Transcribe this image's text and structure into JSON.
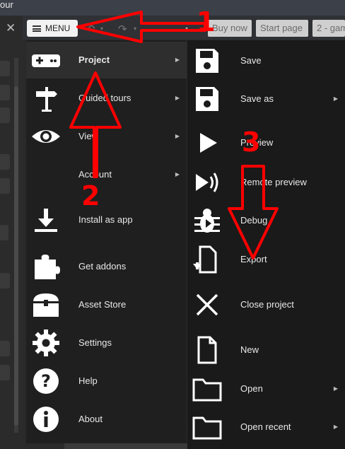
{
  "titlebar": {
    "text": "our"
  },
  "toolbar": {
    "menu_label": "MENU",
    "tabs": [
      "Buy now",
      "Start page",
      "2 - gam"
    ]
  },
  "main_menu": {
    "items": [
      {
        "label": "Project",
        "icon": "gamepad-icon",
        "has_submenu": true,
        "active": true
      },
      {
        "label": "Guided tours",
        "icon": "signpost-icon",
        "has_submenu": true
      },
      {
        "label": "View",
        "icon": "eye-icon",
        "has_submenu": true
      },
      {
        "label": "Account",
        "icon": "blank-icon",
        "has_submenu": true
      },
      {
        "label": "Install as app",
        "icon": "download-icon",
        "has_submenu": false
      },
      {
        "label": "Get addons",
        "icon": "puzzle-icon",
        "has_submenu": false
      },
      {
        "label": "Asset Store",
        "icon": "treasure-chest-icon",
        "has_submenu": false
      },
      {
        "label": "Settings",
        "icon": "gear-icon",
        "has_submenu": false
      },
      {
        "label": "Help",
        "icon": "question-icon",
        "has_submenu": false
      },
      {
        "label": "About",
        "icon": "info-icon",
        "has_submenu": false
      }
    ]
  },
  "sub_menu": {
    "items": [
      {
        "label": "Save",
        "icon": "floppy-disk-icon",
        "has_submenu": false
      },
      {
        "label": "Save as",
        "icon": "floppy-disk-icon",
        "has_submenu": true
      },
      {
        "label": "Preview",
        "icon": "play-icon",
        "has_submenu": false
      },
      {
        "label": "Remote preview",
        "icon": "remote-play-icon",
        "has_submenu": false
      },
      {
        "label": "Debug",
        "icon": "bug-icon",
        "has_submenu": false
      },
      {
        "label": "Export",
        "icon": "export-file-icon",
        "has_submenu": false
      },
      {
        "label": "Close project",
        "icon": "close-x-icon",
        "has_submenu": false
      },
      {
        "label": "New",
        "icon": "new-file-icon",
        "has_submenu": false
      },
      {
        "label": "Open",
        "icon": "folder-icon",
        "has_submenu": true
      },
      {
        "label": "Open recent",
        "icon": "folder-icon",
        "has_submenu": true
      }
    ]
  },
  "annotations": [
    "1",
    "2",
    "3"
  ],
  "colors": {
    "annotation": "#ff0000",
    "menu_bg": "#1f1f1f",
    "submenu_bg": "#1a1a1a"
  }
}
